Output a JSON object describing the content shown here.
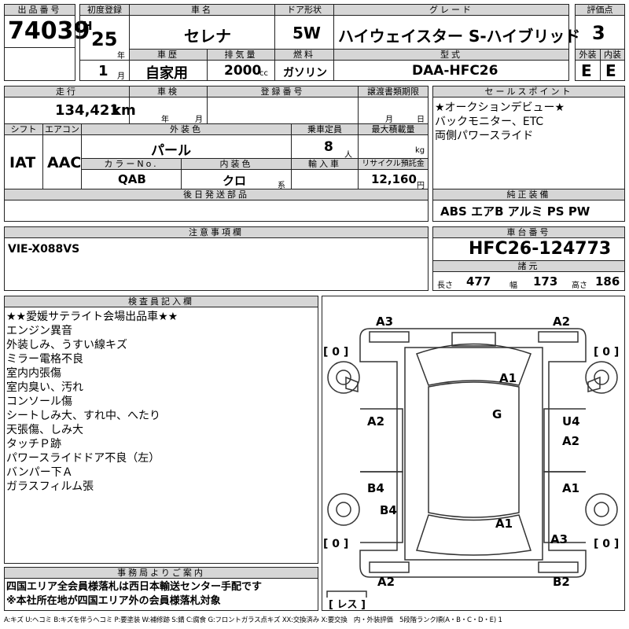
{
  "header": {
    "lot_label": "出品番号",
    "lot": "74039",
    "first_reg_label": "初度登録",
    "era": "H",
    "year": "25",
    "year_unit": "年",
    "month": "1",
    "month_unit": "月",
    "car_name_label": "車名",
    "car_name": "セレナ",
    "door_label": "ドア形状",
    "door": "5W",
    "grade_label": "グレード",
    "grade": "ハイウェイスター S-ハイブリッド",
    "score_label": "評価点",
    "score": "3",
    "history_label": "車歴",
    "history": "自家用",
    "displacement_label": "排気量",
    "displacement": "2000",
    "displacement_unit": "cc",
    "fuel_label": "燃料",
    "fuel": "ガソリン",
    "model_label": "型式",
    "model": "DAA-HFC26",
    "ext_label": "外装",
    "ext": "E",
    "int_label": "内装",
    "int": "E"
  },
  "row2": {
    "mileage_label": "走行",
    "mileage": "134,421",
    "mileage_unit": "km",
    "inspection_label": "車検",
    "year_unit": "年",
    "month_unit": "月",
    "plate_label": "登録番号",
    "transfer_label": "譲渡書類期限",
    "transfer_month_unit": "月",
    "transfer_day_unit": "日",
    "shift_label": "シフト",
    "shift": "IAT",
    "ac_label": "エアコン",
    "ac": "AAC",
    "color_label": "外装色",
    "color": "パール",
    "capacity_label": "乗車定員",
    "capacity": "8",
    "capacity_unit": "人",
    "load_label": "最大積載量",
    "load_unit": "kg",
    "colorno_label": "カラーNo.",
    "colorno": "QAB",
    "interior_color_label": "内装色",
    "interior_color": "クロ",
    "interior_color_unit": "系",
    "import_label": "輸入車",
    "recycle_label": "リサイクル預託金",
    "recycle": "12,160",
    "recycle_unit": "円",
    "later_label": "後日発送部品"
  },
  "sales_points": {
    "label": "セールスポイント",
    "items": [
      "★オークションデビュー★",
      "バックモニター、ETC",
      "両側パワースライド"
    ]
  },
  "equipment": {
    "label": "純正装備",
    "value": "ABS エアB アルミ PS PW"
  },
  "notes": {
    "label": "注意事項欄",
    "value": "VIE-X088VS"
  },
  "chassis": {
    "label": "車台番号",
    "value": "HFC26-124773",
    "dims_label": "諸元",
    "length_label": "長さ",
    "length": "477",
    "width_label": "幅",
    "width": "173",
    "height_label": "高さ",
    "height": "186"
  },
  "inspector": {
    "label": "検査員記入欄",
    "lines": [
      "★★愛媛サテライト会場出品車★★",
      "エンジン異音",
      "外装しみ、うすい線キズ",
      "ミラー電格不良",
      "室内内張傷",
      "室内臭い、汚れ",
      "コンソール傷",
      "シートしみ大、すれ中、へたり",
      "天張傷、しみ大",
      "タッチＰ跡",
      "パワースライドドア不良（左）",
      "バンパー下Ａ",
      "ガラスフィルム張"
    ]
  },
  "office": {
    "label": "事務局よりご案内",
    "lines": [
      "四国エリア全会員様落札は西日本輸送センター手配です",
      "※本社所在地が四国エリア外の会員様落札対象"
    ]
  },
  "diagram": {
    "marks": {
      "A3_tl": "A3",
      "A2_tr": "A2",
      "A1_top": "A1",
      "G": "G",
      "A2_l": "A2",
      "U4": "U4",
      "A2_r": "A2",
      "B4_l1": "B4",
      "A1_r": "A1",
      "B4_l2": "B4",
      "A1_bot": "A1",
      "A3_br": "A3",
      "A2_bl": "A2",
      "B2_br": "B2"
    },
    "tyre_fl": "0",
    "tyre_fr": "0",
    "tyre_rl": "0",
    "tyre_rr": "0",
    "spare": "レス"
  },
  "legend": "A:キズ U:ヘコミ B:キズを伴うヘコミ P:要塗装 W:補修跡 S:錆 C:腐食 G:フロントガラス点キズ XX:交換済み X:要交換　内・外装評価　5段階ランク順(A・B・C・D・E) 1"
}
